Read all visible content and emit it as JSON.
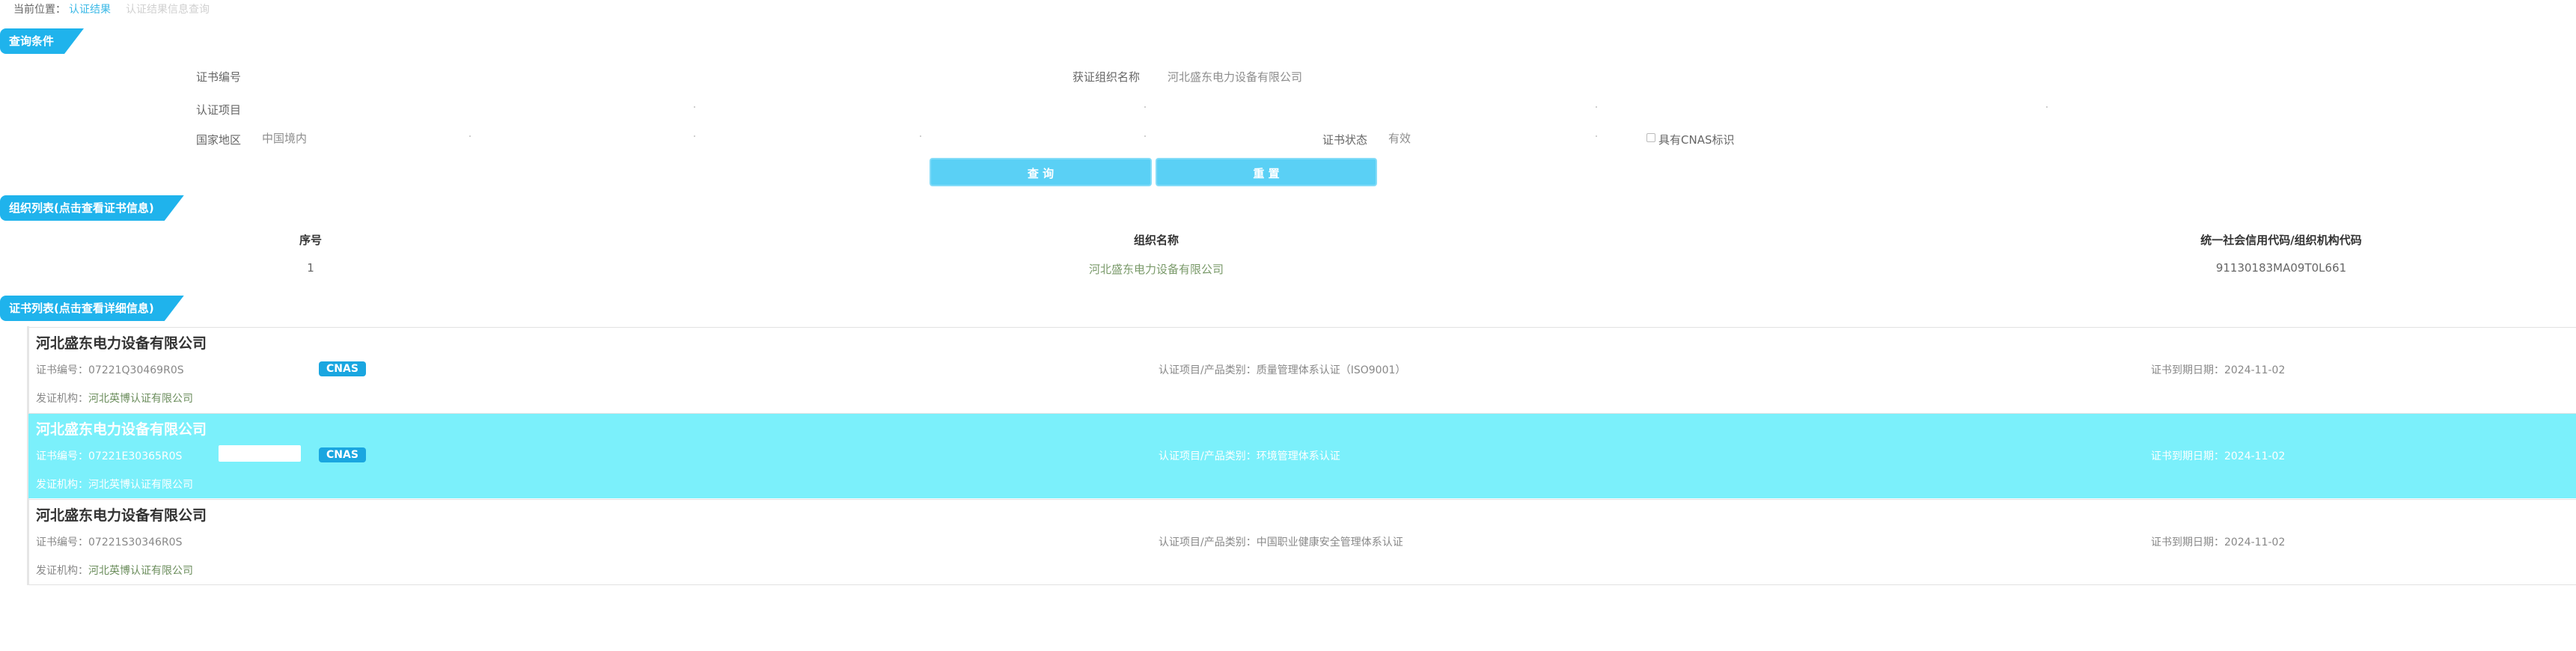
{
  "breadcrumb": {
    "prefix": "当前位置：",
    "current": "认证结果",
    "sub": "认证结果信息查询"
  },
  "query_section": {
    "title": "查询条件",
    "cert_no_label": "证书编号",
    "org_name_label": "获证组织名称",
    "org_name_value": "河北盛东电力设备有限公司",
    "project_label": "认证项目",
    "region_label": "国家地区",
    "region_value": "中国境内",
    "status_label": "证书状态",
    "status_value": "有效",
    "cnas_label": "具有CNAS标识",
    "search_button": "查 询",
    "reset_button": "重 置"
  },
  "org_section": {
    "title": "组织列表(点击查看证书信息)",
    "columns": [
      "序号",
      "组织名称",
      "统一社会信用代码/组织机构代码"
    ],
    "rows": [
      {
        "index": "1",
        "name": "河北盛东电力设备有限公司",
        "code": "91130183MA09T0L661"
      }
    ]
  },
  "cert_section": {
    "title": "证书列表(点击查看详细信息)",
    "items": [
      {
        "org": "河北盛东电力设备有限公司",
        "cert_no_label": "证书编号：",
        "cert_no": "07221Q30469R0S",
        "badge": "CNAS",
        "project_label": "认证项目/产品类别：",
        "project": "质量管理体系认证（ISO9001）",
        "expiry_label": "证书到期日期：",
        "expiry": "2024-11-02",
        "issuer_label": "发证机构：",
        "issuer": "河北英博认证有限公司"
      },
      {
        "org": "河北盛东电力设备有限公司",
        "cert_no_label": "证书编号：",
        "cert_no": "07221E30365R0S",
        "badge": "CNAS",
        "project_label": "认证项目/产品类别：",
        "project": "环境管理体系认证",
        "expiry_label": "证书到期日期：",
        "expiry": "2024-11-02",
        "issuer_label": "发证机构：",
        "issuer": "河北英博认证有限公司"
      },
      {
        "org": "河北盛东电力设备有限公司",
        "cert_no_label": "证书编号：",
        "cert_no": "07221S30346R0S",
        "project_label": "认证项目/产品类别：",
        "project": "中国职业健康安全管理体系认证",
        "expiry_label": "证书到期日期：",
        "expiry": "2024-11-02",
        "issuer_label": "发证机构：",
        "issuer": "河北英博认证有限公司"
      }
    ]
  },
  "colors": {
    "accent": "#1fb3ec",
    "button": "#5ad0f5",
    "highlight_row": "#7bf0fb",
    "badge": "#1aa6e0"
  }
}
